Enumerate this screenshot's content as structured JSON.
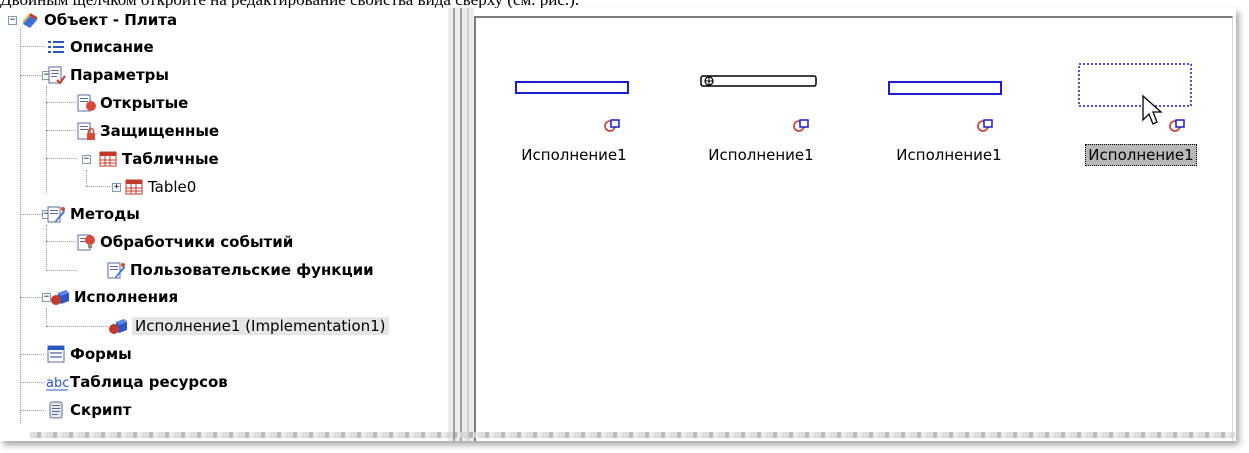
{
  "top_caption": "Двойным щелчком откройте на редактирование свойства вида сверху (см. рис.).",
  "tree": {
    "root": {
      "label": "Объект - Плита",
      "icon": "object-icon",
      "expander": "−"
    },
    "description": {
      "label": "Описание",
      "icon": "list-icon"
    },
    "parameters": {
      "label": "Параметры",
      "icon": "parameters-icon",
      "expander": "−"
    },
    "open": {
      "label": "Открытые",
      "icon": "open-params-icon",
      "expander": "+"
    },
    "protected": {
      "label": "Защищенные",
      "icon": "locked-params-icon",
      "expander": "+"
    },
    "tabular": {
      "label": "Табличные",
      "icon": "table-icon",
      "expander": "−"
    },
    "table0": {
      "label": "Table0",
      "icon": "table-icon",
      "expander": "+"
    },
    "methods": {
      "label": "Методы",
      "icon": "methods-icon",
      "expander": "−"
    },
    "handlers": {
      "label": "Обработчики событий",
      "icon": "event-handler-icon",
      "expander": "+"
    },
    "user_functions": {
      "label": "Пользовательские функции",
      "icon": "user-function-icon"
    },
    "implementations": {
      "label": "Исполнения",
      "icon": "implementation-icon",
      "expander": "−"
    },
    "implementation1": {
      "label": "Исполнение1 (Implementation1)",
      "icon": "implementation-icon"
    },
    "forms": {
      "label": "Формы",
      "icon": "form-icon"
    },
    "resources": {
      "label": "Таблица ресурсов",
      "icon": "abc-icon"
    },
    "script": {
      "label": "Скрипт",
      "icon": "script-icon"
    }
  },
  "canvas": {
    "items": [
      {
        "caption": "Исполнение1",
        "view": "front"
      },
      {
        "caption": "Исполнение1",
        "view": "side"
      },
      {
        "caption": "Исполнение1",
        "view": "back"
      },
      {
        "caption": "Исполнение1",
        "view": "top",
        "selected": true
      }
    ]
  },
  "colors": {
    "outline_blue": "#1c1ccf",
    "selection_gray": "#b8b8b8",
    "pin_red": "#c0392b"
  }
}
